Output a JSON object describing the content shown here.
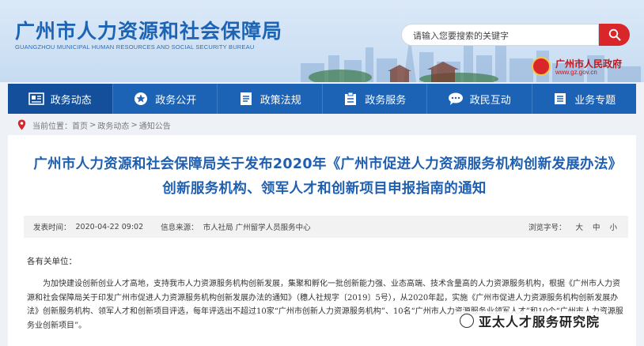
{
  "header": {
    "title": "广州市人力资源和社会保障局",
    "subtitle": "GUANGZHOU MUNICIPAL HUMAN RESOURCES AND SOCIAL SECURITY BUREAU",
    "search_placeholder": "请输入您要搜索的关键字",
    "gov_name": "广州市人民政府",
    "gov_url": "www.gz.gov.cn"
  },
  "nav": {
    "items": [
      {
        "label": "政务动态",
        "icon": "news-icon"
      },
      {
        "label": "政务公开",
        "icon": "star-icon"
      },
      {
        "label": "政策法规",
        "icon": "document-icon"
      },
      {
        "label": "政务服务",
        "icon": "clipboard-icon"
      },
      {
        "label": "政民互动",
        "icon": "chat-icon"
      },
      {
        "label": "业务专题",
        "icon": "list-icon"
      }
    ]
  },
  "breadcrumb": {
    "prefix": "当前位置：",
    "items": [
      "首页",
      "政务动态",
      "通知公告"
    ],
    "separator": ">"
  },
  "article": {
    "title": "广州市人力资源和社会保障局关于发布2020年《广州市促进人力资源服务机构创新发展办法》创新服务机构、领军人才和创新项目申报指南的通知",
    "date_label": "发表时间：",
    "date": "2020-04-22 09:02",
    "source_label": "信息来源：",
    "source": "市人社局 广州留学人员服务中心",
    "font_label": "浏览字号：",
    "font_sizes": [
      "大",
      "中",
      "小"
    ],
    "greeting": "各有关单位：",
    "paragraph": "为加快建设创新创业人才高地，支持我市人力资源服务机构创新发展，集聚和孵化一批创新能力强、业态高端、技术含量高的人力资源服务机构，根据《广州市人力资源和社会保障局关于印发广州市促进人力资源服务机构创新发展办法的通知》（穗人社规字〔2019〕5号），从2020年起，实施《广州市促进人力资源服务机构创新发展办法》创新服务机构、领军人才和创新项目评选，每年评选出不超过10家“广州市创新人力资源服务机构”、10名“广州市人力资源服务业领军人才”和10个“广州市人力资源服务业创新项目”。"
  },
  "watermark": {
    "text": "亚太人才服务研究院"
  },
  "colors": {
    "brand_blue": "#1c62b5",
    "title_blue": "#1f5fb0",
    "accent_red": "#d8262b"
  }
}
